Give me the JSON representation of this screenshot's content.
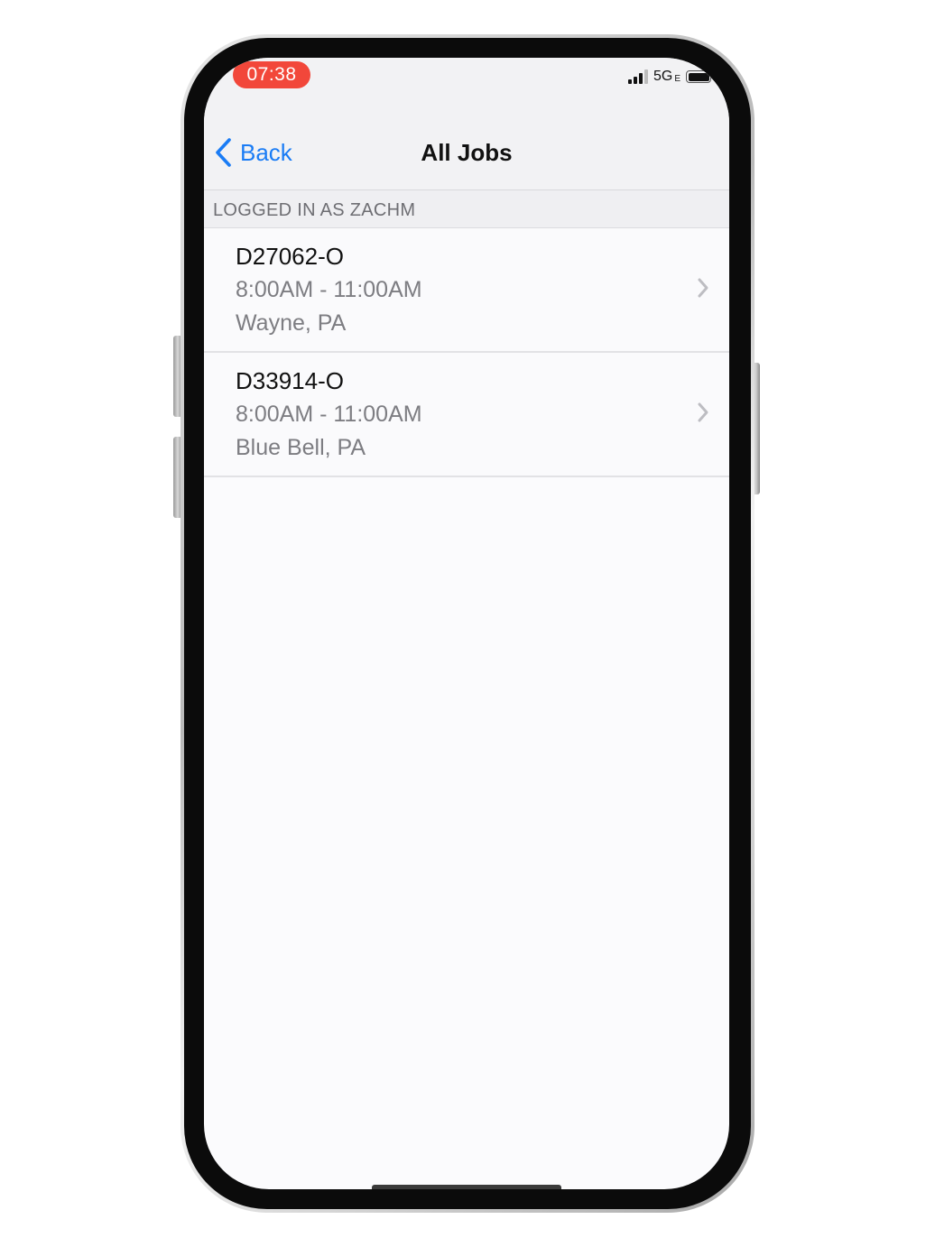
{
  "status_bar": {
    "time": "07:38",
    "network": "5G",
    "network_suffix": "E",
    "time_pill_color": "#f2473a"
  },
  "nav": {
    "back_label": "Back",
    "title": "All Jobs",
    "accent_color": "#1a7cf5"
  },
  "section": {
    "header": "LOGGED IN AS ZACHM"
  },
  "jobs": [
    {
      "id": "D27062-O",
      "time": "8:00AM - 11:00AM",
      "location": "Wayne, PA"
    },
    {
      "id": "D33914-O",
      "time": "8:00AM - 11:00AM",
      "location": "Blue Bell, PA"
    }
  ],
  "icons": {
    "back": "chevron-left-icon",
    "row_disclosure": "chevron-right-icon",
    "signal": "cellular-signal-icon",
    "battery": "battery-icon"
  }
}
